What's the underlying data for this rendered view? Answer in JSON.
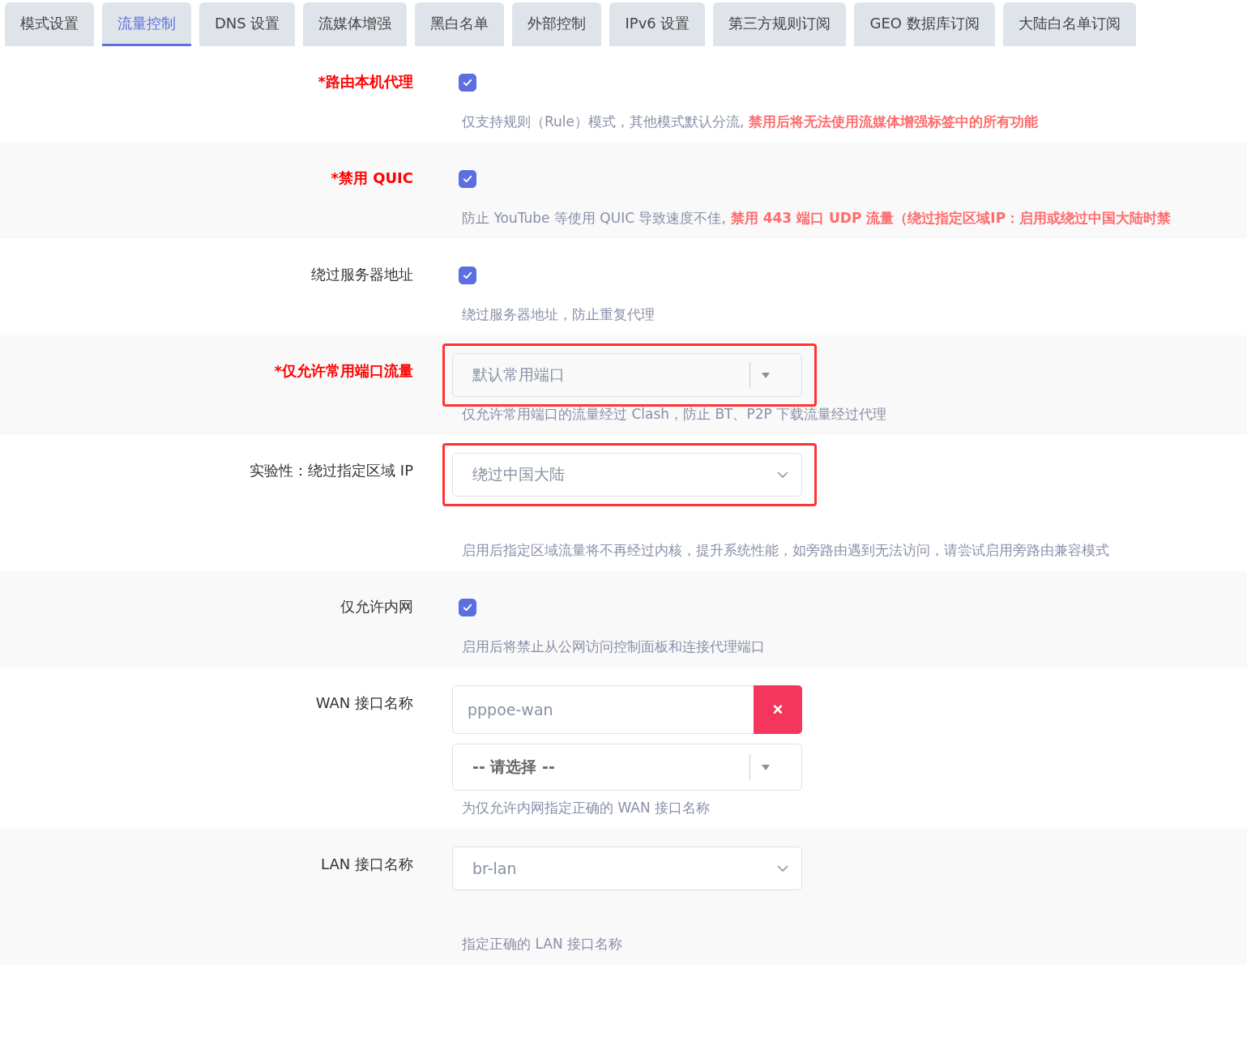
{
  "tabs": [
    {
      "label": "模式设置",
      "selected": false
    },
    {
      "label": "流量控制",
      "selected": true
    },
    {
      "label": "DNS 设置",
      "selected": false
    },
    {
      "label": "流媒体增强",
      "selected": false
    },
    {
      "label": "黑白名单",
      "selected": false
    },
    {
      "label": "外部控制",
      "selected": false
    },
    {
      "label": "IPv6 设置",
      "selected": false
    },
    {
      "label": "第三方规则订阅",
      "selected": false
    },
    {
      "label": "GEO 数据库订阅",
      "selected": false
    },
    {
      "label": "大陆白名单订阅",
      "selected": false
    }
  ],
  "rows": [
    {
      "label": "*路由本机代理",
      "required": true,
      "kind": "checkbox",
      "checked": true,
      "description": "仅支持规则（Rule）模式，其他模式默认分流,",
      "warning": "禁用后将无法使用流媒体增强标签中的所有功能"
    },
    {
      "label": "*禁用 QUIC",
      "required": true,
      "kind": "checkbox",
      "checked": true,
      "description": "防止 YouTube 等使用 QUIC 导致速度不佳,",
      "warning": "禁用 443 端口 UDP 流量（绕过指定区域IP：启用或绕过中国大陆时禁"
    },
    {
      "label": "绕过服务器地址",
      "required": false,
      "kind": "checkbox",
      "checked": true,
      "description": "绕过服务器地址，防止重复代理"
    },
    {
      "label": "*仅允许常用端口流量",
      "required": true,
      "kind": "combo",
      "value": "默认常用端口",
      "highlighted": true,
      "description": "仅允许常用端口的流量经过 Clash，防止 BT、P2P 下载流量经过代理"
    },
    {
      "label": "实验性：绕过指定区域 IP",
      "required": false,
      "kind": "select",
      "value": "绕过中国大陆",
      "highlighted": true,
      "description": "启用后指定区域流量将不再经过内核，提升系统性能，如旁路由遇到无法访问，请尝试启用旁路由兼容模式"
    },
    {
      "label": "仅允许内网",
      "required": false,
      "kind": "checkbox",
      "checked": true,
      "description": "启用后将禁止从公网访问控制面板和连接代理端口"
    },
    {
      "label": "WAN 接口名称",
      "required": false,
      "kind": "list",
      "items": [
        "pppoe-wan"
      ],
      "remove": "×",
      "value": "-- 请选择 --",
      "description": "为仅允许内网指定正确的 WAN 接口名称"
    },
    {
      "label": "LAN 接口名称",
      "required": false,
      "kind": "select",
      "value": "br-lan",
      "description": "指定正确的 LAN 接口名称"
    }
  ]
}
